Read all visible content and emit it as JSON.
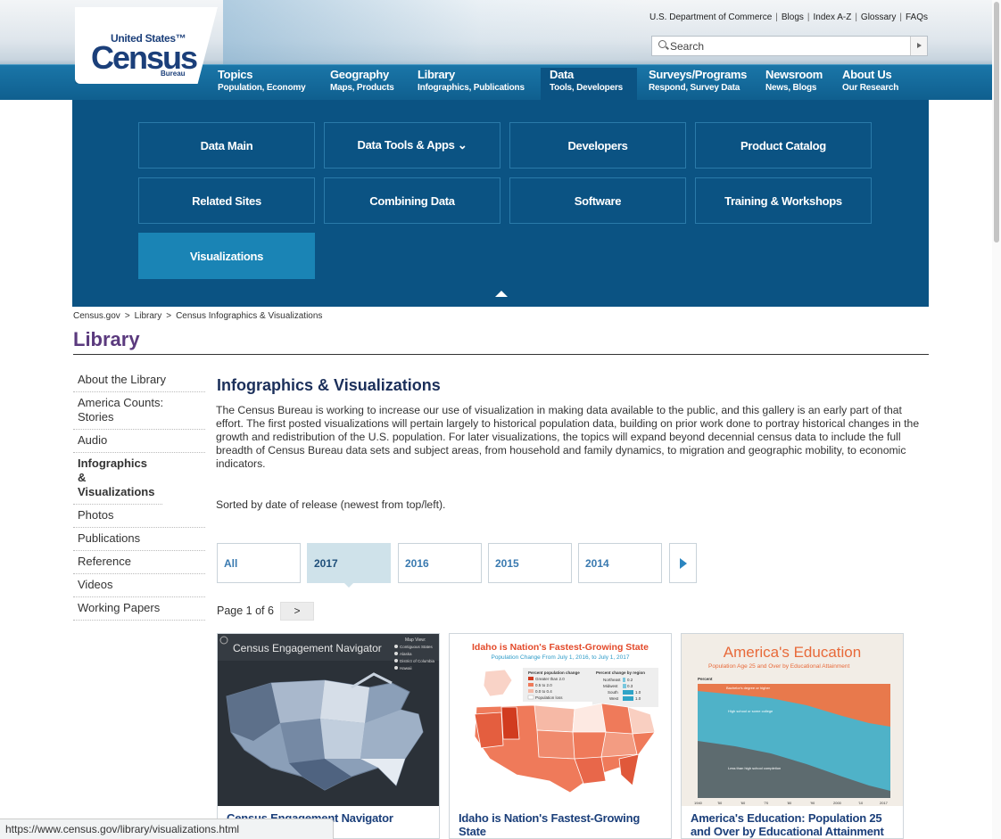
{
  "header": {
    "logo": {
      "top": "United States™",
      "main": "Census",
      "sub": "Bureau"
    },
    "util_links": [
      "U.S. Department of Commerce",
      "Blogs",
      "Index A-Z",
      "Glossary",
      "FAQs"
    ],
    "search_placeholder": "Search"
  },
  "nav": [
    {
      "title": "Topics",
      "sub": "Population, Economy"
    },
    {
      "title": "Geography",
      "sub": "Maps, Products"
    },
    {
      "title": "Library",
      "sub": "Infographics, Publications"
    },
    {
      "title": "Data",
      "sub": "Tools, Developers",
      "active": true
    },
    {
      "title": "Surveys/Programs",
      "sub": "Respond, Survey Data"
    },
    {
      "title": "Newsroom",
      "sub": "News, Blogs"
    },
    {
      "title": "About Us",
      "sub": "Our Research"
    }
  ],
  "mega_menu": [
    "Data Main",
    "Data Tools & Apps ⌄",
    "Developers",
    "Product Catalog",
    "Related Sites",
    "Combining Data",
    "Software",
    "Training & Workshops",
    "Visualizations"
  ],
  "breadcrumb": [
    "Census.gov",
    "Library",
    "Census Infographics & Visualizations"
  ],
  "section_title": "Library",
  "side_nav": [
    "About the Library",
    "America Counts: Stories",
    "Audio",
    "Infographics & Visualizations",
    "Photos",
    "Publications",
    "Reference",
    "Videos",
    "Working Papers"
  ],
  "main": {
    "heading": "Infographics & Visualizations",
    "intro": "The Census Bureau is working to increase our use of visualization in making data available to the public, and this gallery is an early part of that effort. The first posted visualizations will pertain largely to historical population data, building on prior work done to portray historical changes in the growth and redistribution of the U.S. population. For later visualizations, the topics will expand beyond decennial census data to include the full breadth of Census Bureau data sets and subject areas, from household and family dynamics, to migration and geographic mobility, to economic indicators.",
    "sorted": "Sorted by date of release (newest from top/left).",
    "year_tabs": [
      "All",
      "2017",
      "2016",
      "2015",
      "2014"
    ],
    "selected_tab": "2017",
    "pager": {
      "label": "Page 1 of 6",
      "next": ">"
    }
  },
  "cards": [
    {
      "caption": "Census Engagement Navigator",
      "thumb_title": "Census Engagement Navigator",
      "legend": [
        "Map View:",
        "Contiguous States",
        "Alaska",
        "District of Columbia",
        "Hawaii"
      ]
    },
    {
      "caption": "Idaho is Nation's Fastest-Growing State",
      "thumb_title": "Idaho is Nation's Fastest-Growing State",
      "thumb_sub": "Population Change From July 1, 2016, to July 1, 2017",
      "legend_title": "Percent population change",
      "legend": [
        "Greater than 2.0",
        "0.5 to 2.0",
        "0.0 to 0.4",
        "Population loss"
      ],
      "region_title": "Percent change by region",
      "regions": [
        {
          "name": "Northeast",
          "value": "0.2"
        },
        {
          "name": "Midwest",
          "value": "0.3"
        },
        {
          "name": "South",
          "value": "1.0"
        },
        {
          "name": "West",
          "value": "1.0"
        }
      ]
    },
    {
      "caption": "America's Education: Population 25 and Over by Educational Attainment",
      "thumb_title": "America's Education",
      "thumb_sub": "Population Age 25 and Over by Educational Attainment",
      "bands": [
        "Bachelor's degree or higher",
        "High school or some college",
        "Less than high school completion"
      ],
      "ylabel": "Percent",
      "xticks": [
        "1940",
        "'50",
        "'60",
        "'70",
        "'80",
        "'90",
        "2000",
        "'10",
        "2017"
      ]
    }
  ],
  "status_url": "https://www.census.gov/library/visualizations.html",
  "colors": {
    "nav": "#0f5f8f",
    "mega": "#0b5383",
    "title_purple": "#5b3a7e",
    "link_blue": "#1b3f7a"
  }
}
